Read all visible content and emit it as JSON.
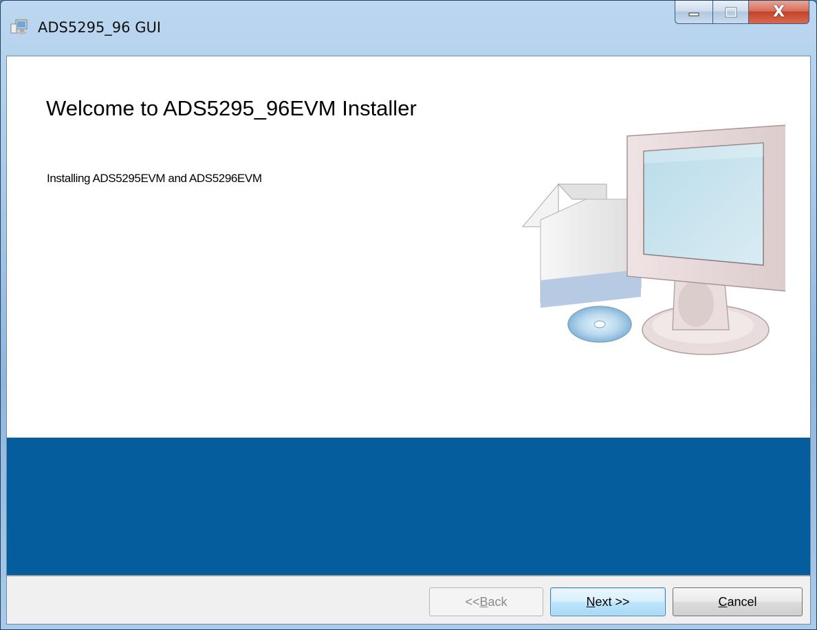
{
  "window": {
    "title": "ADS5295_96 GUI",
    "icon": "installer-app-icon",
    "controls": {
      "minimize_icon": "minimize-icon",
      "maximize_icon": "maximize-icon",
      "close_label": "X"
    }
  },
  "banner": {
    "heading": "Welcome to ADS5295_96EVM Installer",
    "description": "Installing ADS5295EVM and ADS5296EVM",
    "illustration": "computer-setup-illustration"
  },
  "colors": {
    "accent_band": "#055d9e",
    "button_bar": "#f0f0f0"
  },
  "buttons": {
    "back": {
      "prefix": "<< ",
      "mnemonic": "B",
      "rest": "ack",
      "enabled": false
    },
    "next": {
      "mnemonic": "N",
      "rest": "ext >>",
      "enabled": true,
      "default": true
    },
    "cancel": {
      "mnemonic": "C",
      "rest": "ancel",
      "enabled": true
    }
  }
}
